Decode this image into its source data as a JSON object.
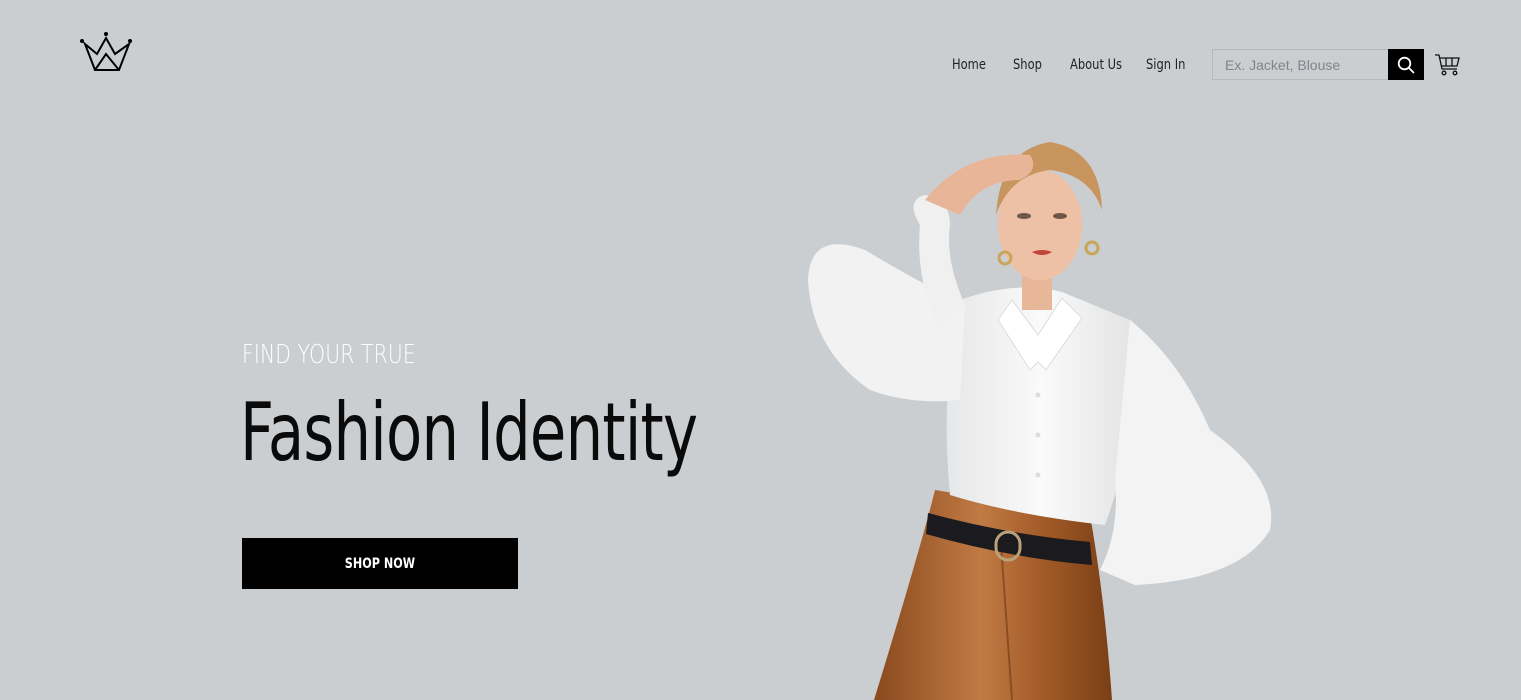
{
  "header": {
    "logo": "crown-icon",
    "nav": [
      {
        "label": "Home"
      },
      {
        "label": "Shop"
      },
      {
        "label": "About Us"
      },
      {
        "label": "Sign In"
      }
    ],
    "search": {
      "placeholder": "Ex. Jacket, Blouse",
      "value": "",
      "icon": "search-icon"
    },
    "cart_icon": "cart-icon"
  },
  "hero": {
    "kicker": "FIND YOUR TRUE",
    "title": "Fashion Identity",
    "cta_label": "SHOP NOW",
    "image": "model-photo"
  },
  "colors": {
    "background": "#cbced1",
    "button": "#000000",
    "kicker": "#ffffff",
    "shirt": "#f4f4f4",
    "pants": "#a8602c"
  }
}
